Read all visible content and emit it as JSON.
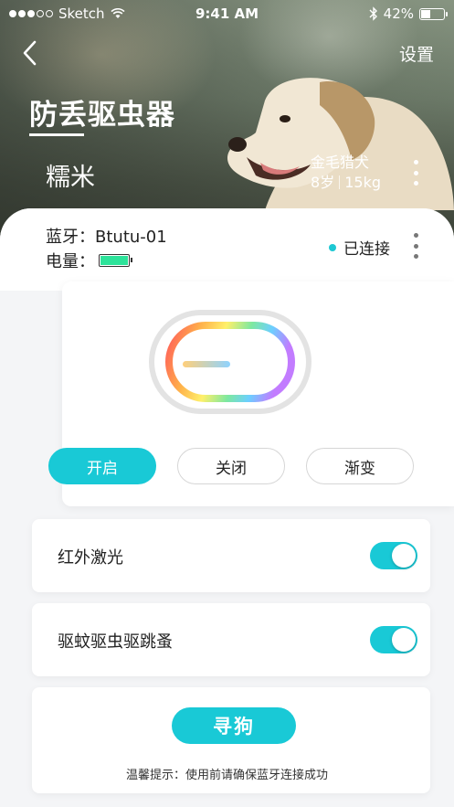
{
  "status_bar": {
    "carrier": "Sketch",
    "time": "9:41 AM",
    "battery_pct": "42%",
    "battery_level": 0.42
  },
  "header": {
    "settings_label": "设置",
    "title": "防丢驱虫器",
    "pet_name": "糯米",
    "breed": "金毛猎犬",
    "age": "8岁",
    "weight": "15kg"
  },
  "device": {
    "bluetooth_label": "蓝牙：Btutu-01",
    "power_label": "电量：",
    "power_level": 1.0,
    "connection_status": "已连接"
  },
  "modes": [
    {
      "label": "开启",
      "active": true
    },
    {
      "label": "关闭",
      "active": false
    },
    {
      "label": "渐变",
      "active": false
    }
  ],
  "toggles": [
    {
      "label": "红外激光",
      "on": true
    },
    {
      "label": "驱蚊驱虫驱跳蚤",
      "on": true
    }
  ],
  "find": {
    "button_label": "寻狗",
    "tip": "温馨提示：使用前请确保蓝牙连接成功"
  },
  "colors": {
    "accent": "#19c9d6",
    "battery_fill": "#2de39a"
  },
  "icons": [
    "back-chevron-icon",
    "wifi-icon",
    "bluetooth-icon",
    "more-vertical-icon"
  ]
}
